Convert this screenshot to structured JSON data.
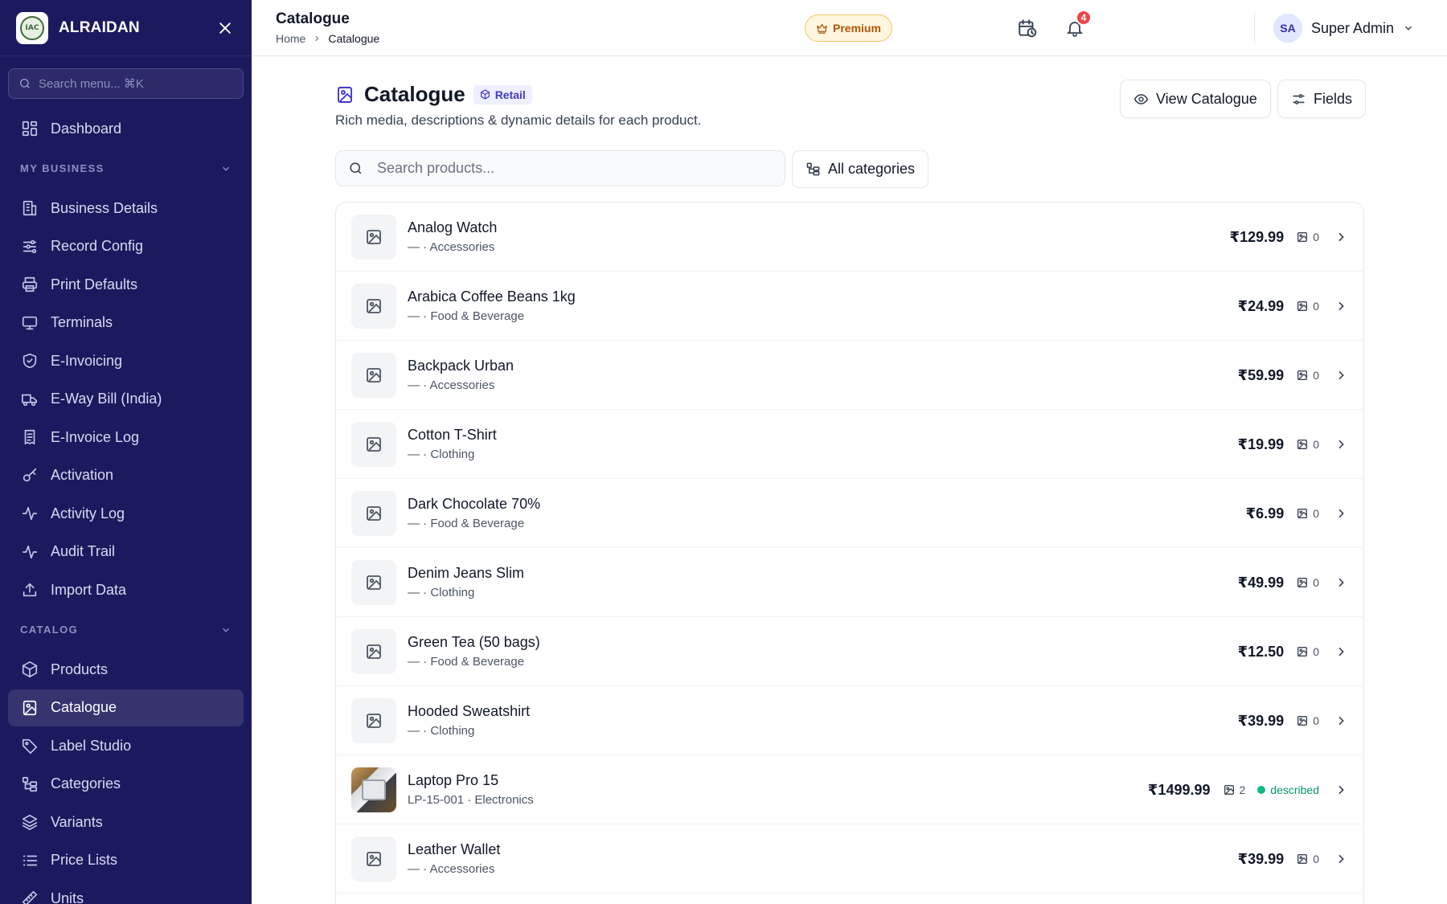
{
  "brand": {
    "name": "ALRAIDAN",
    "logo_text": "IAC"
  },
  "sidebar": {
    "search_placeholder": "Search menu... ⌘K",
    "top_items": [
      {
        "label": "Dashboard",
        "icon": "dashboard-icon"
      }
    ],
    "sections": [
      {
        "title": "MY BUSINESS",
        "items": [
          {
            "label": "Business Details",
            "icon": "building-icon"
          },
          {
            "label": "Record Config",
            "icon": "sliders-icon"
          },
          {
            "label": "Print Defaults",
            "icon": "printer-icon"
          },
          {
            "label": "Terminals",
            "icon": "monitor-icon"
          },
          {
            "label": "E-Invoicing",
            "icon": "shield-check-icon"
          },
          {
            "label": "E-Way Bill (India)",
            "icon": "truck-icon"
          },
          {
            "label": "E-Invoice Log",
            "icon": "receipt-icon"
          },
          {
            "label": "Activation",
            "icon": "key-icon"
          },
          {
            "label": "Activity Log",
            "icon": "activity-icon"
          },
          {
            "label": "Audit Trail",
            "icon": "activity-icon"
          },
          {
            "label": "Import Data",
            "icon": "upload-icon"
          }
        ]
      },
      {
        "title": "CATALOG",
        "items": [
          {
            "label": "Products",
            "icon": "package-icon"
          },
          {
            "label": "Catalogue",
            "icon": "image-book-icon",
            "active": true
          },
          {
            "label": "Label Studio",
            "icon": "tag-icon"
          },
          {
            "label": "Categories",
            "icon": "tree-icon"
          },
          {
            "label": "Variants",
            "icon": "layers-icon"
          },
          {
            "label": "Price Lists",
            "icon": "list-icon"
          },
          {
            "label": "Units",
            "icon": "ruler-icon"
          }
        ]
      }
    ]
  },
  "header": {
    "title": "Catalogue",
    "breadcrumb": {
      "home": "Home",
      "current": "Catalogue"
    },
    "premium_label": "Premium",
    "notifications_count": "4",
    "user": {
      "initials": "SA",
      "name": "Super Admin"
    }
  },
  "page": {
    "title": "Catalogue",
    "tag": "Retail",
    "subtitle": "Rich media, descriptions & dynamic details for each product.",
    "view_catalogue_label": "View Catalogue",
    "fields_label": "Fields",
    "search_placeholder": "Search products...",
    "category_filter_label": "All categories"
  },
  "products": [
    {
      "name": "Analog Watch",
      "meta": "— · Accessories",
      "price": "₹129.99",
      "images": "0"
    },
    {
      "name": "Arabica Coffee Beans 1kg",
      "meta": "— · Food & Beverage",
      "price": "₹24.99",
      "images": "0"
    },
    {
      "name": "Backpack Urban",
      "meta": "— · Accessories",
      "price": "₹59.99",
      "images": "0"
    },
    {
      "name": "Cotton T-Shirt",
      "meta": "— · Clothing",
      "price": "₹19.99",
      "images": "0"
    },
    {
      "name": "Dark Chocolate 70%",
      "meta": "— · Food & Beverage",
      "price": "₹6.99",
      "images": "0"
    },
    {
      "name": "Denim Jeans Slim",
      "meta": "— · Clothing",
      "price": "₹49.99",
      "images": "0"
    },
    {
      "name": "Green Tea (50 bags)",
      "meta": "— · Food & Beverage",
      "price": "₹12.50",
      "images": "0"
    },
    {
      "name": "Hooded Sweatshirt",
      "meta": "— · Clothing",
      "price": "₹39.99",
      "images": "0"
    },
    {
      "name": "Laptop Pro 15",
      "meta": "LP-15-001 · Electronics",
      "price": "₹1499.99",
      "images": "2",
      "status": "described",
      "has_photo": true
    },
    {
      "name": "Leather Wallet",
      "meta": "— · Accessories",
      "price": "₹39.99",
      "images": "0"
    }
  ]
}
